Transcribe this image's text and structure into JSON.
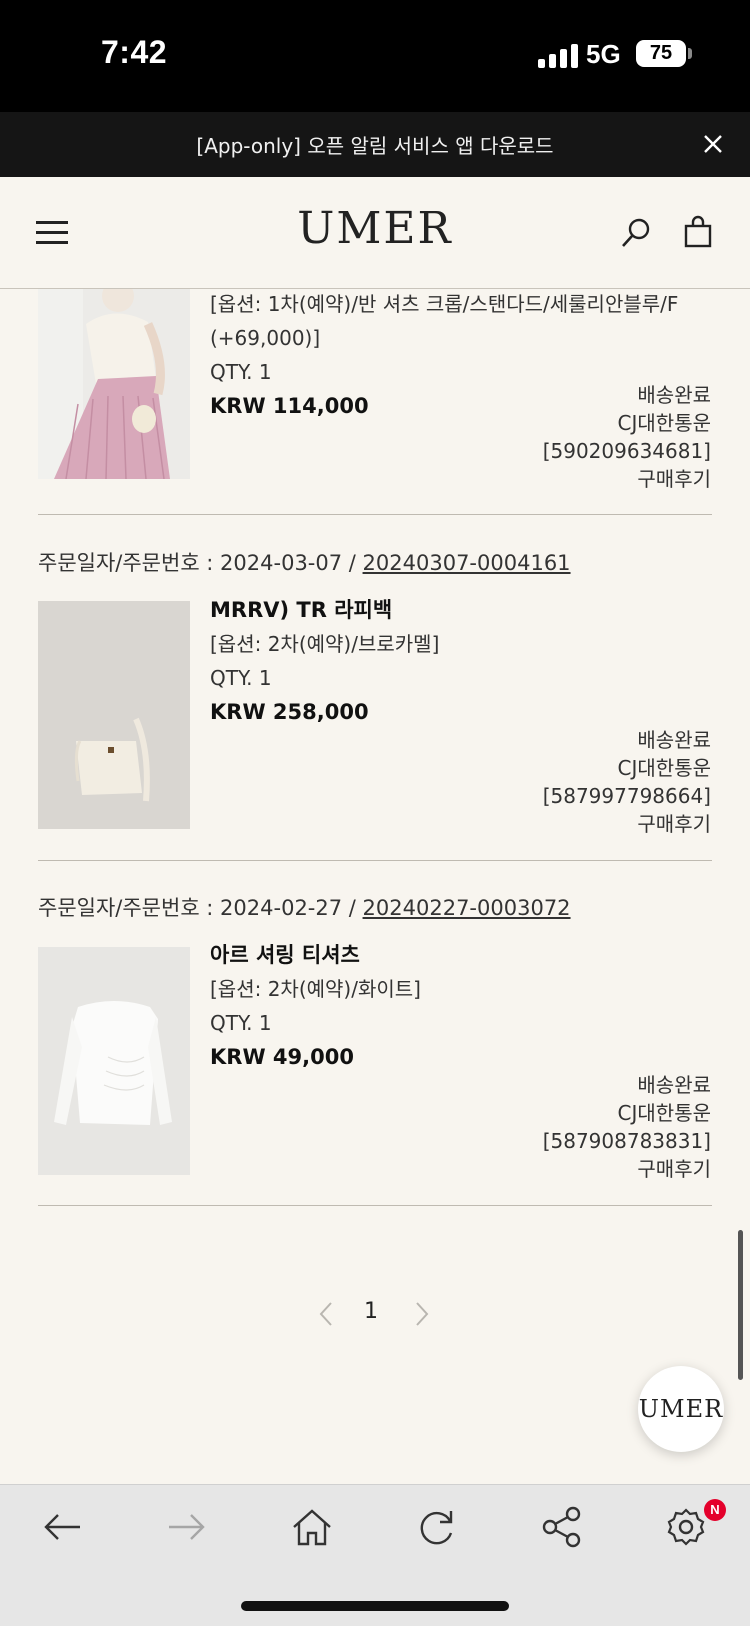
{
  "status_bar": {
    "time": "7:42",
    "network": "5G",
    "battery": "75"
  },
  "banner": {
    "text": "[App-only] 오픈 알림 서비스 앱 다운로드"
  },
  "header": {
    "logo": "UMER"
  },
  "orders": [
    {
      "date_label": "",
      "order_number": "",
      "product_name": "",
      "option": "[옵션: 1차(예약)/반 셔츠 크롭/스탠다드/세룰리안블루/F",
      "option_cont": "(+69,000)]",
      "qty": "QTY. 1",
      "price": "KRW 114,000",
      "status": "배송완료",
      "carrier": "CJ대한통운",
      "tracking": "[590209634681]",
      "review": "구매후기"
    },
    {
      "date_label": "주문일자/주문번호 : 2024-03-07 /",
      "order_number": "20240307-0004161",
      "product_name": "MRRV) TR 라피백",
      "option": "[옵션: 2차(예약)/브로카멜]",
      "qty": "QTY. 1",
      "price": "KRW 258,000",
      "status": "배송완료",
      "carrier": "CJ대한통운",
      "tracking": "[587997798664]",
      "review": "구매후기"
    },
    {
      "date_label": "주문일자/주문번호 : 2024-02-27 /",
      "order_number": "20240227-0003072",
      "product_name": "아르 셔링 티셔츠",
      "option": "[옵션: 2차(예약)/화이트]",
      "qty": "QTY. 1",
      "price": "KRW 49,000",
      "status": "배송완료",
      "carrier": "CJ대한통운",
      "tracking": "[587908783831]",
      "review": "구매후기"
    }
  ],
  "pagination": {
    "current": "1"
  },
  "fab": {
    "label": "UMER"
  },
  "toolbar": {
    "badge": "N"
  },
  "colors": {
    "background": "#f8f5ef",
    "banner": "#151515",
    "badge": "#e4002b"
  }
}
